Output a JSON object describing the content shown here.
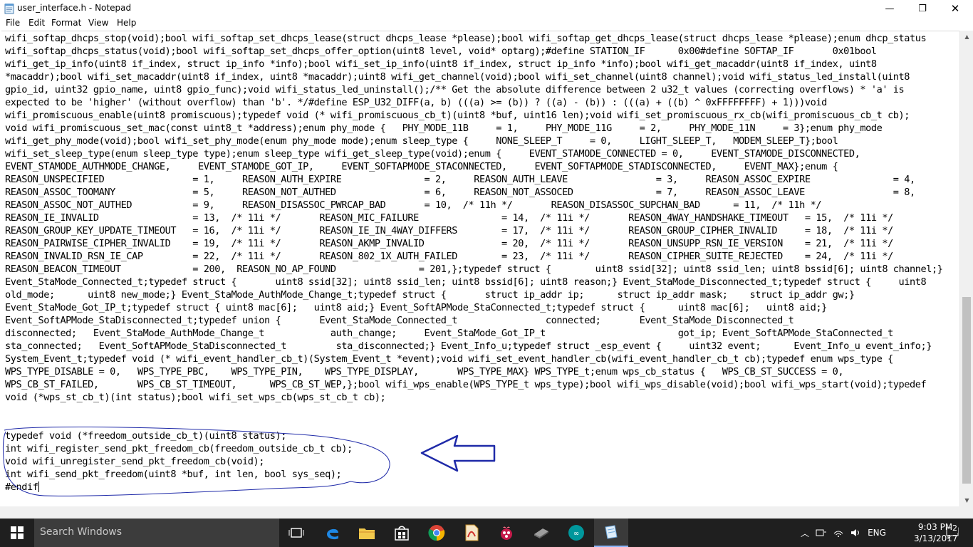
{
  "window": {
    "title": "user_interface.h - Notepad",
    "minimize_glyph": "—",
    "maximize_glyph": "❐",
    "close_glyph": "✕"
  },
  "menu": [
    "File",
    "Edit",
    "Format",
    "View",
    "Help"
  ],
  "editor": {
    "lines": [
      "wifi_softap_dhcps_stop(void);bool wifi_softap_set_dhcps_lease(struct dhcps_lease *please);bool wifi_softap_get_dhcps_lease(struct dhcps_lease *please);enum dhcp_status",
      "wifi_softap_dhcps_status(void);bool wifi_softap_set_dhcps_offer_option(uint8 level, void* optarg);#define STATION_IF      0x00#define SOFTAP_IF       0x01bool",
      "wifi_get_ip_info(uint8 if_index, struct ip_info *info);bool wifi_set_ip_info(uint8 if_index, struct ip_info *info);bool wifi_get_macaddr(uint8 if_index, uint8",
      "*macaddr);bool wifi_set_macaddr(uint8 if_index, uint8 *macaddr);uint8 wifi_get_channel(void);bool wifi_set_channel(uint8 channel);void wifi_status_led_install(uint8",
      "gpio_id, uint32 gpio_name, uint8 gpio_func);void wifi_status_led_uninstall();/** Get the absolute difference between 2 u32_t values (correcting overflows) * 'a' is",
      "expected to be 'higher' (without overflow) than 'b'. */#define ESP_U32_DIFF(a, b) (((a) >= (b)) ? ((a) - (b)) : (((a) + ((b) ^ 0xFFFFFFFF) + 1)))void",
      "wifi_promiscuous_enable(uint8 promiscuous);typedef void (* wifi_promiscuous_cb_t)(uint8 *buf, uint16 len);void wifi_set_promiscuous_rx_cb(wifi_promiscuous_cb_t cb);",
      "void wifi_promiscuous_set_mac(const uint8_t *address);enum phy_mode {   PHY_MODE_11B     = 1,     PHY_MODE_11G     = 2,     PHY_MODE_11N     = 3};enum phy_mode",
      "wifi_get_phy_mode(void);bool wifi_set_phy_mode(enum phy_mode mode);enum sleep_type {     NONE_SLEEP_T     = 0,     LIGHT_SLEEP_T,   MODEM_SLEEP_T};bool",
      "wifi_set_sleep_type(enum sleep_type type);enum sleep_type wifi_get_sleep_type(void);enum {     EVENT_STAMODE_CONNECTED = 0,     EVENT_STAMODE_DISCONNECTED,",
      "EVENT_STAMODE_AUTHMODE_CHANGE,     EVENT_STAMODE_GOT_IP,     EVENT_SOFTAPMODE_STACONNECTED,     EVENT_SOFTAPMODE_STADISCONNECTED,     EVENT_MAX};enum {",
      "REASON_UNSPECIFIED                = 1,     REASON_AUTH_EXPIRE               = 2,     REASON_AUTH_LEAVE                = 3,     REASON_ASSOC_EXPIRE               = 4,",
      "REASON_ASSOC_TOOMANY              = 5,     REASON_NOT_AUTHED                = 6,     REASON_NOT_ASSOCED               = 7,     REASON_ASSOC_LEAVE                = 8,",
      "REASON_ASSOC_NOT_AUTHED           = 9,     REASON_DISASSOC_PWRCAP_BAD       = 10,  /* 11h */       REASON_DISASSOC_SUPCHAN_BAD      = 11,  /* 11h */",
      "REASON_IE_INVALID                 = 13,  /* 11i */       REASON_MIC_FAILURE               = 14,  /* 11i */       REASON_4WAY_HANDSHAKE_TIMEOUT   = 15,  /* 11i */",
      "REASON_GROUP_KEY_UPDATE_TIMEOUT   = 16,  /* 11i */       REASON_IE_IN_4WAY_DIFFERS        = 17,  /* 11i */       REASON_GROUP_CIPHER_INVALID     = 18,  /* 11i */",
      "REASON_PAIRWISE_CIPHER_INVALID    = 19,  /* 11i */       REASON_AKMP_INVALID              = 20,  /* 11i */       REASON_UNSUPP_RSN_IE_VERSION    = 21,  /* 11i */",
      "REASON_INVALID_RSN_IE_CAP         = 22,  /* 11i */       REASON_802_1X_AUTH_FAILED        = 23,  /* 11i */       REASON_CIPHER_SUITE_REJECTED    = 24,  /* 11i */",
      "REASON_BEACON_TIMEOUT             = 200,  REASON_NO_AP_FOUND               = 201,};typedef struct {        uint8 ssid[32]; uint8 ssid_len; uint8 bssid[6]; uint8 channel;}",
      "Event_StaMode_Connected_t;typedef struct {       uint8 ssid[32]; uint8 ssid_len; uint8 bssid[6]; uint8 reason;} Event_StaMode_Disconnected_t;typedef struct {     uint8",
      "old_mode;      uint8 new_mode;} Event_StaMode_AuthMode_Change_t;typedef struct {       struct ip_addr ip;      struct ip_addr mask;    struct ip_addr gw;}",
      "Event_StaMode_Got_IP_t;typedef struct { uint8 mac[6];   uint8 aid;} Event_SoftAPMode_StaConnected_t;typedef struct {      uint8 mac[6];   uint8 aid;}",
      "Event_SoftAPMode_StaDisconnected_t;typedef union {       Event_StaMode_Connected_t                connected;       Event_StaMode_Disconnected_t",
      "disconnected;   Event_StaMode_AuthMode_Change_t            auth_change;     Event_StaMode_Got_IP_t                        got_ip; Event_SoftAPMode_StaConnected_t",
      "sta_connected;   Event_SoftAPMode_StaDisconnected_t         sta_disconnected;} Event_Info_u;typedef struct _esp_event {     uint32 event;      Event_Info_u event_info;}",
      "System_Event_t;typedef void (* wifi_event_handler_cb_t)(System_Event_t *event);void wifi_set_event_handler_cb(wifi_event_handler_cb_t cb);typedef enum wps_type {",
      "WPS_TYPE_DISABLE = 0,   WPS_TYPE_PBC,    WPS_TYPE_PIN,    WPS_TYPE_DISPLAY,       WPS_TYPE_MAX} WPS_TYPE_t;enum wps_cb_status {   WPS_CB_ST_SUCCESS = 0,",
      "WPS_CB_ST_FAILED,       WPS_CB_ST_TIMEOUT,      WPS_CB_ST_WEP,};bool wifi_wps_enable(WPS_TYPE_t wps_type);bool wifi_wps_disable(void);bool wifi_wps_start(void);typedef",
      "void (*wps_st_cb_t)(int status);bool wifi_set_wps_cb(wps_st_cb_t cb);",
      "",
      "",
      "typedef void (*freedom_outside_cb_t)(uint8 status);",
      "int wifi_register_send_pkt_freedom_cb(freedom_outside_cb_t cb);",
      "void wifi_unregister_send_pkt_freedom_cb(void);",
      "int wifi_send_pkt_freedom(uint8 *buf, int len, bool sys_seq);",
      "#endif"
    ]
  },
  "taskbar": {
    "search_placeholder": "Search Windows",
    "language": "ENG",
    "time": "9:03 PM",
    "date": "3/13/2017",
    "notification_count": "2"
  },
  "colors": {
    "annotation_ink": "#1f2aa8",
    "taskbar_bg": "#1f1f1f",
    "edge_blue": "#1e88e5"
  }
}
